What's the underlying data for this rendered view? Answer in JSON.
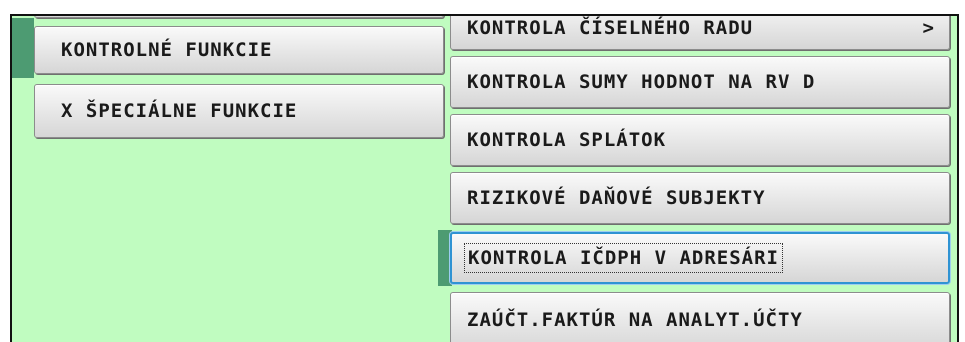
{
  "left_menu": {
    "items": [
      {
        "label": ""
      },
      {
        "label": "KONTROLNÉ FUNKCIE"
      },
      {
        "label": "X ŠPECIÁLNE FUNKCIE"
      }
    ]
  },
  "submenu": {
    "items": [
      {
        "label": "KONTROLA ČÍSELNÉHO RADU",
        "arrow": ">"
      },
      {
        "label": "KONTROLA SUMY HODNOT NA RV D"
      },
      {
        "label": "KONTROLA SPLÁTOK"
      },
      {
        "label": "RIZIKOVÉ DAŇOVÉ SUBJEKTY"
      },
      {
        "label": "KONTROLA IČDPH V ADRESÁRI"
      },
      {
        "label": "ZAÚČT.FAKTÚR NA ANALYT.ÚČTY"
      }
    ]
  },
  "colors": {
    "background": "#c0fcc0",
    "selection_strip": "#4d9b72",
    "focus_border": "#2f93d3"
  }
}
